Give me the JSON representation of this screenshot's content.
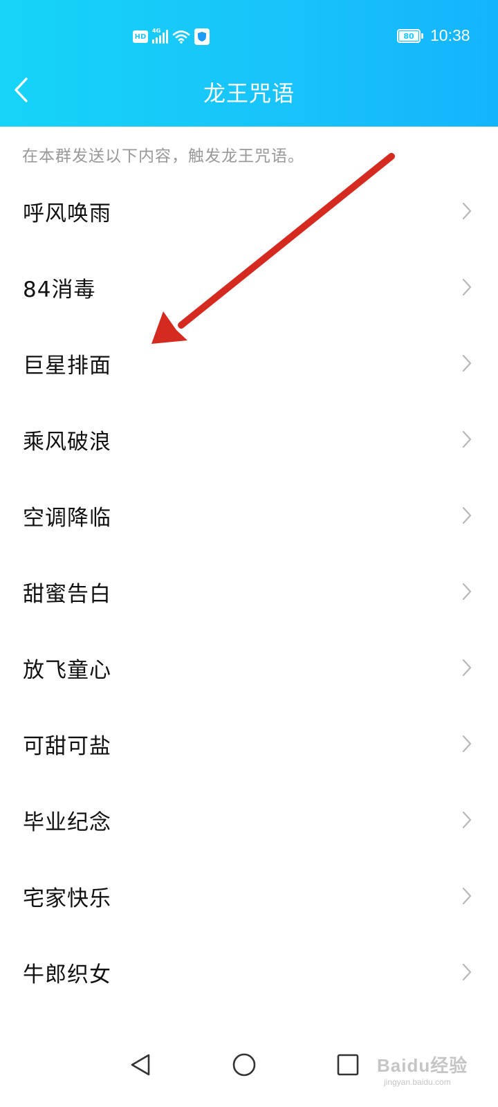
{
  "status_bar": {
    "hd_label": "HD",
    "network_label": "4G",
    "battery": "80",
    "time": "10:38",
    "icons": [
      "hd-icon",
      "signal-icon",
      "wifi-icon",
      "shield-icon",
      "battery-icon"
    ]
  },
  "header": {
    "back_icon": "chevron-left-icon",
    "title": "龙王咒语"
  },
  "hint": "在本群发送以下内容，触发龙王咒语。",
  "list": {
    "items": [
      {
        "label": "呼风唤雨"
      },
      {
        "label": "84消毒"
      },
      {
        "label": "巨星排面"
      },
      {
        "label": "乘风破浪"
      },
      {
        "label": "空调降临"
      },
      {
        "label": "甜蜜告白"
      },
      {
        "label": "放飞童心"
      },
      {
        "label": "可甜可盐"
      },
      {
        "label": "毕业纪念"
      },
      {
        "label": "宅家快乐"
      },
      {
        "label": "牛郎织女"
      }
    ],
    "chevron_icon": "chevron-right-icon"
  },
  "system_nav": {
    "icons": [
      "back-triangle-icon",
      "home-circle-icon",
      "recents-square-icon"
    ]
  },
  "watermark": {
    "logo": "Baidu经验",
    "sub": "jingyan.baidu.com"
  },
  "colors": {
    "header_gradient_start": "#16d4f8",
    "header_gradient_end": "#14b4fc",
    "annotation_arrow": "#d42a20",
    "hint_text": "#999999",
    "item_text": "#111111",
    "chevron": "#b8b8b8"
  }
}
